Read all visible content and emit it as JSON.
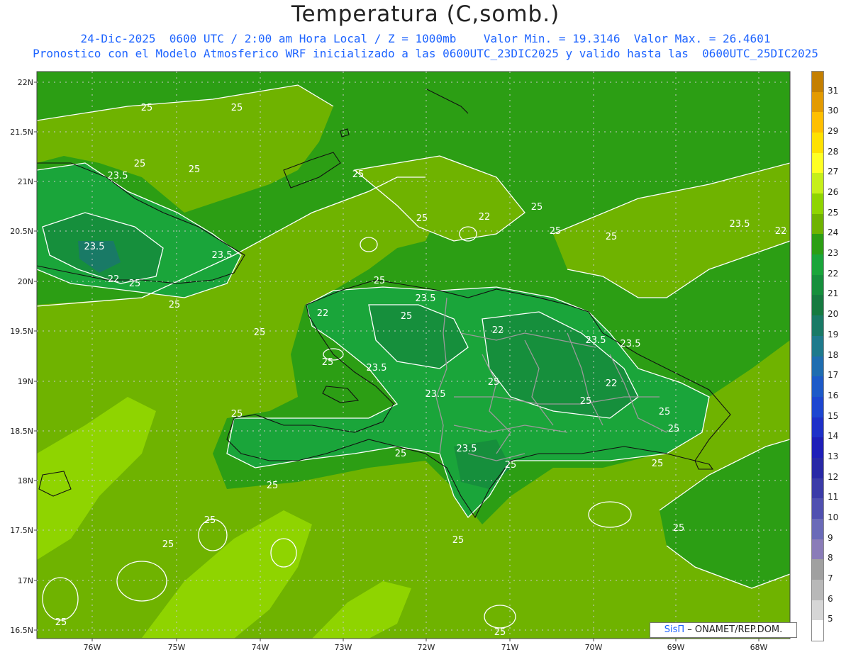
{
  "title": "Temperatura (C,somb.)",
  "subtitle_line1": "24-Dic-2025  0600 UTC / 2:00 am Hora Local / Z = 1000mb    Valor Min. = 19.3146  Valor Max. = 26.4601",
  "subtitle_line2": "Pronostico con el Modelo Atmosferico WRF inicializado a las 0600UTC_23DIC2025 y valido hasta las  0600UTC_25DIC2025",
  "lat_ticks": [
    "22N",
    "21.5N",
    "21N",
    "20.5N",
    "20N",
    "19.5N",
    "19N",
    "18.5N",
    "18N",
    "17.5N",
    "17N",
    "16.5N"
  ],
  "lon_ticks": [
    "76W",
    "75W",
    "74W",
    "73W",
    "72W",
    "71W",
    "70W",
    "69W",
    "68W"
  ],
  "colorbar": {
    "labels": [
      "31",
      "30",
      "29",
      "28",
      "27",
      "26",
      "25",
      "24",
      "23",
      "22",
      "21",
      "20",
      "19",
      "18",
      "17",
      "16",
      "15",
      "14",
      "13",
      "12",
      "11",
      "10",
      "9",
      "8",
      "7",
      "6",
      "5"
    ],
    "colors": [
      "#c47f00",
      "#e39a00",
      "#ffbf00",
      "#ffe100",
      "#ffff24",
      "#c6ef1a",
      "#8fd400",
      "#6fb300",
      "#2c9e14",
      "#1aa53a",
      "#168f3c",
      "#167a40",
      "#197a66",
      "#1e7a8c",
      "#1f6db0",
      "#1d5ac8",
      "#1d46d0",
      "#1e30c8",
      "#1e1eb8",
      "#2828a6",
      "#3b3ba8",
      "#5050b0",
      "#6a6ab8",
      "#8a7cb8",
      "#a0a0a0",
      "#b8b8b8",
      "#d6d6d6",
      "#ffffff"
    ]
  },
  "contour_labels": [
    "25",
    "25",
    "23.5",
    "25",
    "25",
    "25",
    "25",
    "22",
    "23.5",
    "23.5",
    "22",
    "25",
    "25",
    "25",
    "25",
    "25",
    "25",
    "25",
    "25",
    "23.5",
    "22",
    "22",
    "25",
    "23.5",
    "23.5",
    "23.5",
    "22",
    "25",
    "23.5",
    "23.5",
    "22",
    "25",
    "25",
    "25",
    "25",
    "25",
    "23.5",
    "25",
    "25",
    "25",
    "25",
    "25",
    "25",
    "25"
  ],
  "credit": {
    "logo": "SisΠ",
    "text": " – ONAMET/REP.DOM."
  }
}
